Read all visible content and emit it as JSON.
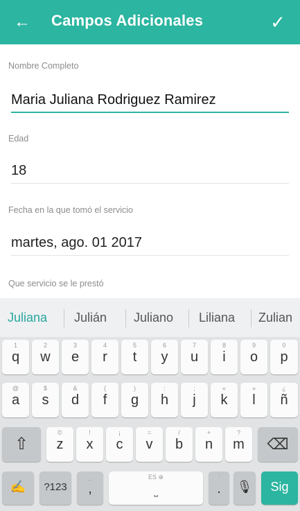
{
  "appbar": {
    "title": "Campos Adicionales",
    "back_icon": "arrow-left-icon",
    "confirm_icon": "check-icon",
    "color": "#2cb5a0"
  },
  "form": {
    "nombre": {
      "label": "Nombre Completo",
      "value": "Maria Juliana Rodriguez Ramirez"
    },
    "edad": {
      "label": "Edad",
      "value": "18"
    },
    "fecha": {
      "label": "Fecha en la que tomó el servicio",
      "value": "martes, ago. 01 2017"
    },
    "servicio": {
      "label": "Que servicio se le prestó"
    }
  },
  "keyboard": {
    "suggestions": [
      "Juliana",
      "Julián",
      "Juliano",
      "Liliana",
      "Zulian"
    ],
    "row1": [
      {
        "hint": "1",
        "ch": "q"
      },
      {
        "hint": "2",
        "ch": "w"
      },
      {
        "hint": "3",
        "ch": "e"
      },
      {
        "hint": "4",
        "ch": "r"
      },
      {
        "hint": "5",
        "ch": "t"
      },
      {
        "hint": "6",
        "ch": "y"
      },
      {
        "hint": "7",
        "ch": "u"
      },
      {
        "hint": "8",
        "ch": "i"
      },
      {
        "hint": "9",
        "ch": "o"
      },
      {
        "hint": "0",
        "ch": "p"
      }
    ],
    "row2": [
      {
        "hint": "@",
        "ch": "a"
      },
      {
        "hint": "$",
        "ch": "s"
      },
      {
        "hint": "&",
        "ch": "d"
      },
      {
        "hint": "(",
        "ch": "f"
      },
      {
        "hint": ")",
        "ch": "g"
      },
      {
        "hint": ":",
        "ch": "h"
      },
      {
        "hint": ";",
        "ch": "j"
      },
      {
        "hint": "«",
        "ch": "k"
      },
      {
        "hint": "»",
        "ch": "l"
      },
      {
        "hint": "¿",
        "ch": "ñ"
      }
    ],
    "row3": [
      {
        "hint": "©",
        "ch": "z"
      },
      {
        "hint": "!",
        "ch": "x"
      },
      {
        "hint": "¡",
        "ch": "c"
      },
      {
        "hint": "=",
        "ch": "v"
      },
      {
        "hint": "/",
        "ch": "b"
      },
      {
        "hint": "+",
        "ch": "n"
      },
      {
        "hint": "?",
        "ch": "m"
      }
    ],
    "shift_icon": "shift-icon",
    "backspace_icon": "backspace-icon",
    "handwriting_icon": "handwriting-icon",
    "numbers_label": "?123",
    "comma_label": ",",
    "comma_hint": "_",
    "space_hint": "ES ⊕",
    "period_label": ".",
    "period_hint": "'",
    "mic_icon": "microphone-icon",
    "enter_label": "Sig"
  }
}
